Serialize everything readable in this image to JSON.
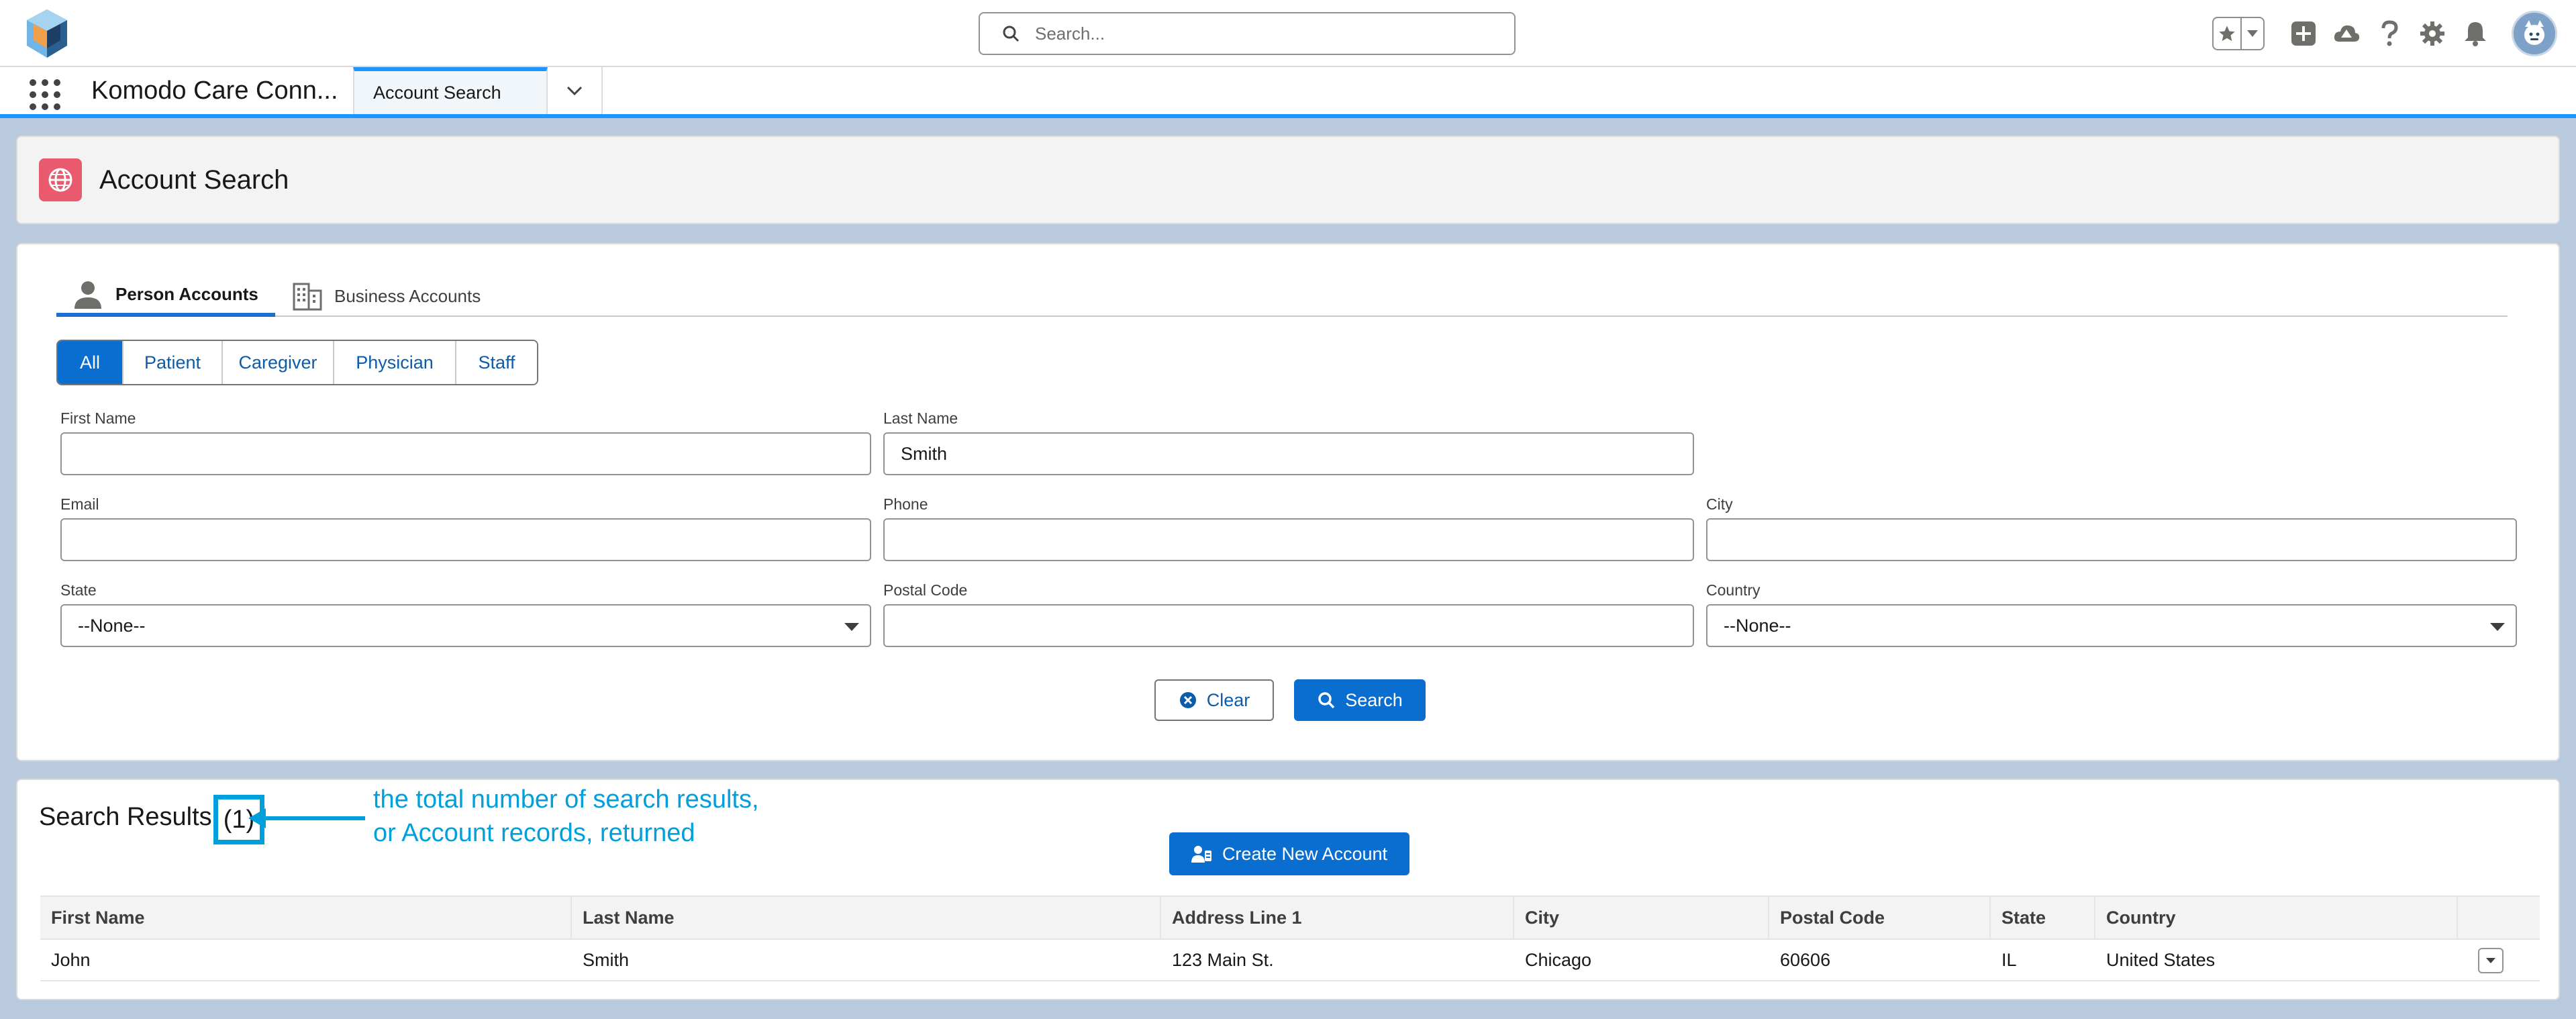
{
  "global_header": {
    "search_placeholder": "Search...",
    "icons": [
      "app-logo-icon",
      "favorites-star-icon",
      "favorites-dropdown-icon",
      "global-actions-plus-icon",
      "trailhead-guidance-icon",
      "help-icon",
      "setup-gear-icon",
      "notifications-bell-icon",
      "user-avatar"
    ]
  },
  "app_nav": {
    "app_name": "Komodo Care Conn...",
    "active_tab": "Account Search"
  },
  "page_header": {
    "title": "Account Search"
  },
  "search": {
    "tabs": [
      {
        "label": "Person Accounts",
        "active": true
      },
      {
        "label": "Business Accounts",
        "active": false
      }
    ],
    "filters": [
      "All",
      "Patient",
      "Caregiver",
      "Physician",
      "Staff"
    ],
    "selected_filter": "All",
    "fields": {
      "first_name": {
        "label": "First Name",
        "value": ""
      },
      "last_name": {
        "label": "Last Name",
        "value": "Smith"
      },
      "email": {
        "label": "Email",
        "value": ""
      },
      "phone": {
        "label": "Phone",
        "value": ""
      },
      "city": {
        "label": "City",
        "value": ""
      },
      "state": {
        "label": "State",
        "value": "--None--"
      },
      "postal_code": {
        "label": "Postal Code",
        "value": ""
      },
      "country": {
        "label": "Country",
        "value": "--None--"
      }
    },
    "clear_label": "Clear",
    "search_label": "Search"
  },
  "results": {
    "title": "Search Results",
    "count": "(1)",
    "create_label": "Create New Account",
    "annotation_line1": "the total number of search results,",
    "annotation_line2": "or Account records, returned",
    "columns": [
      "First Name",
      "Last Name",
      "Address Line 1",
      "City",
      "Postal Code",
      "State",
      "Country"
    ],
    "rows": [
      [
        "John",
        "Smith",
        "123 Main St.",
        "Chicago",
        "60606",
        "IL",
        "United States"
      ]
    ]
  },
  "colors": {
    "brand": "#0a6ed1",
    "accent": "#1b96ff",
    "annotation": "#00a0dc",
    "page_icon": "#ea5a6f"
  }
}
